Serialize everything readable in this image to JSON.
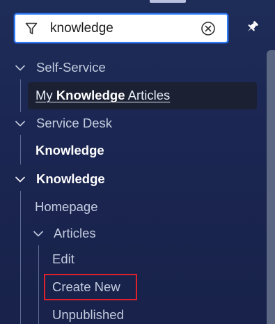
{
  "search": {
    "value": "knowledge",
    "filter_icon": "filter-icon",
    "clear_icon": "circle-x-icon"
  },
  "pin_icon": "pin-icon",
  "nav": {
    "self_service": {
      "label": "Self-Service",
      "expanded": true,
      "item": {
        "prefix": "My ",
        "match": "Knowledge",
        "suffix": " Articles",
        "selected": true
      }
    },
    "service_desk": {
      "label": "Service Desk",
      "expanded": true,
      "item": "Knowledge"
    },
    "knowledge": {
      "label": "Knowledge",
      "expanded": true,
      "homepage": "Homepage",
      "articles": {
        "label": "Articles",
        "expanded": true,
        "items": [
          "Edit",
          "Create New",
          "Unpublished"
        ]
      }
    }
  },
  "colors": {
    "background": "#1d2b55",
    "search_border": "#2f7cf6",
    "highlight_border": "#e0202a",
    "text": "#c4ccdf",
    "text_bold": "#ffffff"
  }
}
